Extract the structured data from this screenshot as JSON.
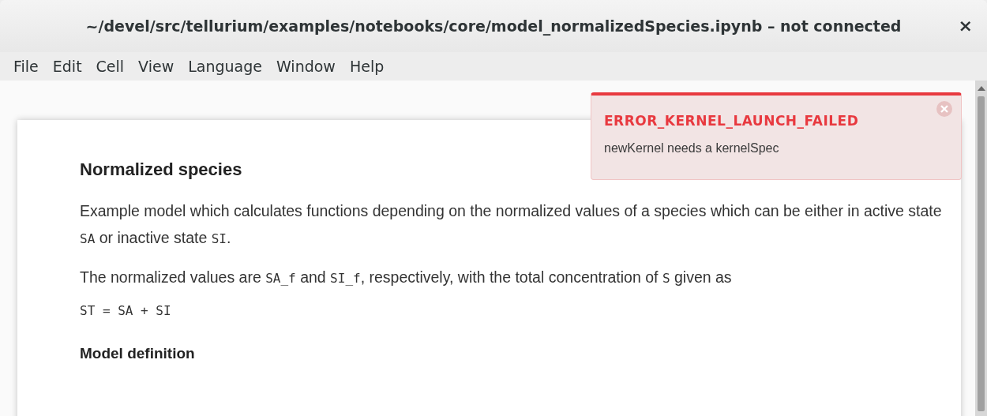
{
  "window": {
    "title": "~/devel/src/tellurium/examples/notebooks/core/model_normalizedSpecies.ipynb – not connected",
    "close": "×"
  },
  "menu": [
    "File",
    "Edit",
    "Cell",
    "View",
    "Language",
    "Window",
    "Help"
  ],
  "notebook": [
    {
      "kind": "heading",
      "text": "Normalized species"
    },
    {
      "kind": "paragraph",
      "segments": [
        {
          "kind": "text",
          "text": "Example model which calculates functions depending on the normalized values of a species which can be either in active state "
        },
        {
          "kind": "code",
          "text": "SA"
        },
        {
          "kind": "text",
          "text": " or inactive state "
        },
        {
          "kind": "code",
          "text": "SI"
        },
        {
          "kind": "text",
          "text": "."
        }
      ]
    },
    {
      "kind": "paragraph",
      "segments": [
        {
          "kind": "text",
          "text": "The normalized values are "
        },
        {
          "kind": "code",
          "text": "SA_f"
        },
        {
          "kind": "text",
          "text": " and "
        },
        {
          "kind": "code",
          "text": "SI_f"
        },
        {
          "kind": "text",
          "text": ", respectively, with the total concentration of "
        },
        {
          "kind": "code",
          "text": "S"
        },
        {
          "kind": "text",
          "text": " given as"
        }
      ]
    },
    {
      "kind": "code",
      "text": "ST = SA + SI"
    },
    {
      "kind": "subheading",
      "text": "Model definition"
    }
  ],
  "notification": {
    "title": "ERROR_KERNEL_LAUNCH_FAILED",
    "message": "newKernel needs a kernelSpec"
  }
}
